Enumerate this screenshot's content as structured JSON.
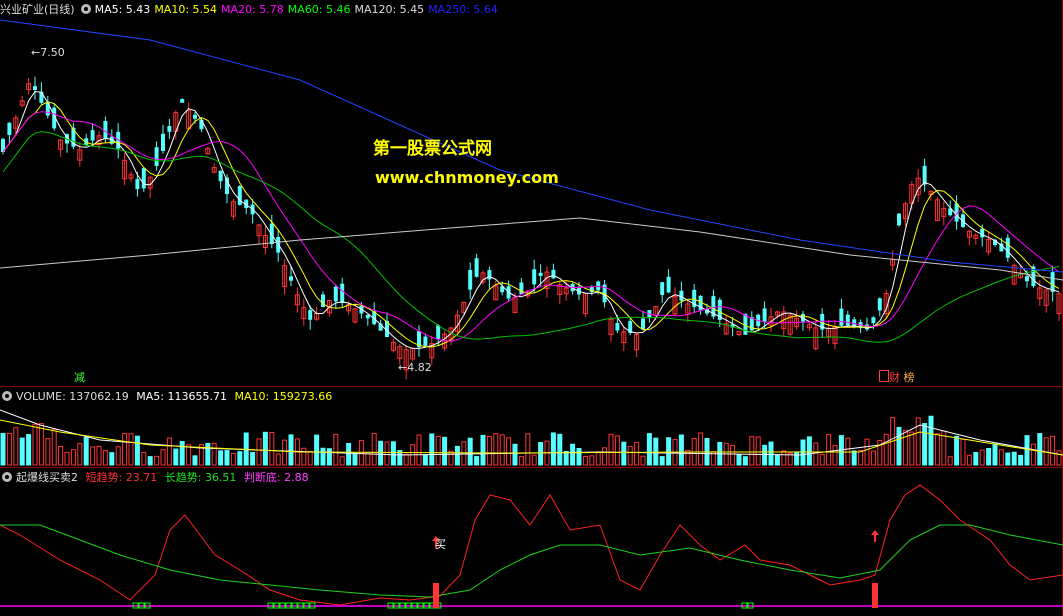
{
  "price_panel": {
    "stock_name": "兴业矿业(日线)",
    "ma": [
      {
        "label": "MA5:",
        "value": "5.43",
        "color": "#ffffff"
      },
      {
        "label": "MA10:",
        "value": "5.54",
        "color": "#ffff00"
      },
      {
        "label": "MA20:",
        "value": "5.78",
        "color": "#ff00ff"
      },
      {
        "label": "MA60:",
        "value": "5.46",
        "color": "#00ff00"
      },
      {
        "label": "MA120:",
        "value": "5.45",
        "color": "#dddddd"
      },
      {
        "label": "MA250:",
        "value": "5.64",
        "color": "#2222ff"
      }
    ],
    "high_marker": "7.50",
    "low_marker": "4.82",
    "watermark_title": "第一股票公式网",
    "watermark_url": "www.chnmoney.com",
    "tag_left": "减",
    "tag_right_1": "财",
    "tag_right_2": "榜"
  },
  "volume_panel": {
    "label": "VOLUME:",
    "value": "137062.19",
    "ma5_label": "MA5:",
    "ma5_value": "113655.71",
    "ma10_label": "MA10:",
    "ma10_value": "159273.66"
  },
  "indicator_panel": {
    "name": "起爆线买卖2",
    "short_label": "短趋势:",
    "short_value": "23.71",
    "long_label": "长趋势:",
    "long_value": "36.51",
    "judge_label": "判断底:",
    "judge_value": "2.88",
    "buy_label": "买"
  },
  "colors": {
    "up": "#ff3333",
    "down": "#54ffff",
    "grid": "#8b0000",
    "short_trend": "#ff2020",
    "long_trend": "#20d020",
    "judge": "#ff00ff",
    "watermark": "#ffff00"
  }
}
